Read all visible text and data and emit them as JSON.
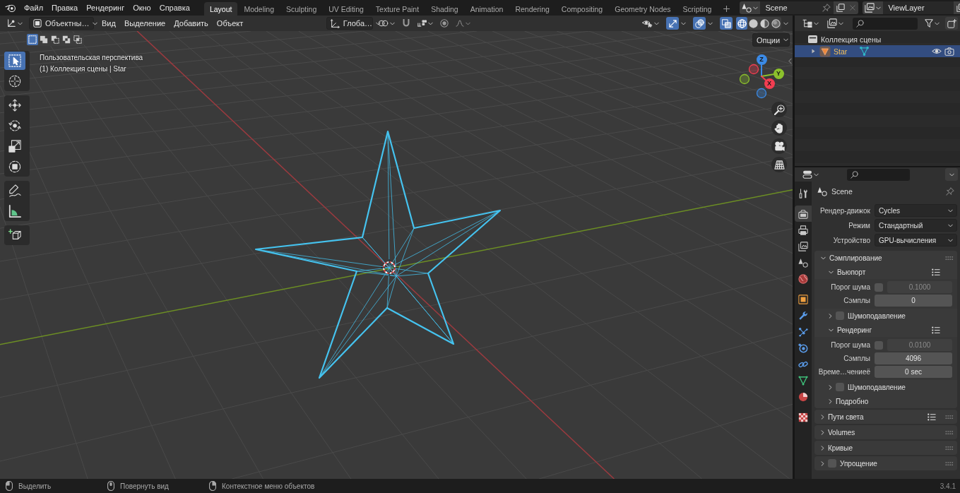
{
  "top_bar": {
    "menus": [
      "Файл",
      "Правка",
      "Рендеринг",
      "Окно",
      "Справка"
    ],
    "workspaces": [
      {
        "label": "Layout",
        "selected": true
      },
      {
        "label": "Modeling",
        "selected": false
      },
      {
        "label": "Sculpting",
        "selected": false
      },
      {
        "label": "UV Editing",
        "selected": false
      },
      {
        "label": "Texture Paint",
        "selected": false
      },
      {
        "label": "Shading",
        "selected": false
      },
      {
        "label": "Animation",
        "selected": false
      },
      {
        "label": "Rendering",
        "selected": false
      },
      {
        "label": "Compositing",
        "selected": false
      },
      {
        "label": "Geometry Nodes",
        "selected": false
      },
      {
        "label": "Scripting",
        "selected": false
      }
    ],
    "scene": {
      "value": "Scene"
    },
    "view_layer": {
      "value": "ViewLayer"
    }
  },
  "viewport": {
    "header": {
      "mode": "Объектны…",
      "menus": [
        "Вид",
        "Выделение",
        "Добавить",
        "Объект"
      ],
      "orientation": "Глоба…",
      "toggles": [
        {
          "kind": "visibility",
          "on": false
        },
        {
          "kind": "gizmos",
          "on": true
        },
        {
          "kind": "overlays",
          "on": true
        },
        {
          "kind": "xray",
          "on": true
        }
      ],
      "shading": [
        {
          "kind": "wireframe",
          "selected": true
        },
        {
          "kind": "solid",
          "selected": false
        },
        {
          "kind": "material",
          "selected": false
        },
        {
          "kind": "rendered",
          "selected": false
        }
      ]
    },
    "select_modes": [
      {
        "kind": "set",
        "selected": true
      },
      {
        "kind": "extend",
        "selected": false
      },
      {
        "kind": "subtract",
        "selected": false
      },
      {
        "kind": "invert",
        "selected": false
      },
      {
        "kind": "intersect",
        "selected": false
      }
    ],
    "options_button": "Опции",
    "info": {
      "view": "Пользовательская перспектива",
      "context": "(1) Коллекция сцены | Star"
    },
    "tools": [
      {
        "kind": "select_box",
        "selected": true
      },
      {
        "kind": "cursor",
        "selected": false
      },
      {
        "kind": "move",
        "selected": false
      },
      {
        "kind": "rotate",
        "selected": false
      },
      {
        "kind": "scale",
        "selected": false
      },
      {
        "kind": "transform",
        "selected": false
      },
      {
        "kind": "annotate",
        "selected": false
      },
      {
        "kind": "measure",
        "selected": false
      },
      {
        "kind": "add_cube",
        "selected": false
      }
    ],
    "gizmo_axes": [
      {
        "label": "Z",
        "color": "#3b8ae6"
      },
      {
        "label": "Y",
        "color": "#8cc12c"
      },
      {
        "label": "X",
        "color": "#f23d51"
      }
    ]
  },
  "outliner": {
    "tree": [
      {
        "kind": "collection",
        "label": "Коллекция сцены",
        "children": [
          {
            "kind": "object",
            "label": "Star",
            "selected": true,
            "expanded": false
          }
        ]
      }
    ]
  },
  "properties": {
    "tabs": [
      {
        "kind": "tool",
        "selected": false
      },
      {
        "kind": "render",
        "selected": true
      },
      {
        "kind": "output",
        "selected": false
      },
      {
        "kind": "view_layer",
        "selected": false
      },
      {
        "kind": "scene",
        "selected": false
      },
      {
        "kind": "world",
        "selected": false
      },
      {
        "kind": "object",
        "selected": false
      },
      {
        "kind": "modifiers",
        "selected": false
      },
      {
        "kind": "particles",
        "selected": false
      },
      {
        "kind": "physics",
        "selected": false
      },
      {
        "kind": "constraints",
        "selected": false
      },
      {
        "kind": "data",
        "selected": false
      },
      {
        "kind": "material",
        "selected": false
      },
      {
        "kind": "texture",
        "selected": false
      }
    ],
    "context": "Scene",
    "fields": [
      {
        "label": "Рендер-движок",
        "value": "Cycles"
      },
      {
        "label": "Режим",
        "value": "Стандартный"
      },
      {
        "label": "Устройство",
        "value": "GPU-вычисления"
      }
    ],
    "panels": [
      {
        "title": "Сэмплирование",
        "expanded": true,
        "panels": [
          {
            "title": "Вьюпорт",
            "expanded": true,
            "presets": true,
            "rows": [
              {
                "kind": "toggle_number",
                "label": "Порог шума",
                "checked": false,
                "value": "0.1000"
              },
              {
                "kind": "number",
                "label": "Сэмплы",
                "value": "0"
              }
            ],
            "panels": [
              {
                "title": "Шумоподавление",
                "expanded": false,
                "checked": false
              }
            ]
          },
          {
            "title": "Рендеринг",
            "expanded": true,
            "presets": true,
            "rows": [
              {
                "kind": "toggle_number",
                "label": "Порог шума",
                "checked": false,
                "value": "0.0100"
              },
              {
                "kind": "number",
                "label": "Сэмплы",
                "value": "4096"
              },
              {
                "kind": "number",
                "label": "Време…чениеё",
                "value": "0 sec"
              }
            ],
            "panels": [
              {
                "title": "Шумоподавление",
                "expanded": false,
                "checked": false
              },
              {
                "title": "Подробно",
                "expanded": false
              }
            ]
          }
        ]
      },
      {
        "title": "Пути света",
        "expanded": false,
        "presets": true
      },
      {
        "title": "Volumes",
        "expanded": false
      },
      {
        "title": "Кривые",
        "expanded": false
      },
      {
        "title": "Упрощение",
        "expanded": false,
        "checked": false
      }
    ]
  },
  "status_bar": {
    "hints": [
      {
        "kind": "left_click",
        "label": "Выделить"
      },
      {
        "kind": "middle_click",
        "label": "Повернуть вид"
      },
      {
        "kind": "right_click",
        "label": "Контекстное меню объектов"
      }
    ],
    "version": "3.4.1"
  }
}
